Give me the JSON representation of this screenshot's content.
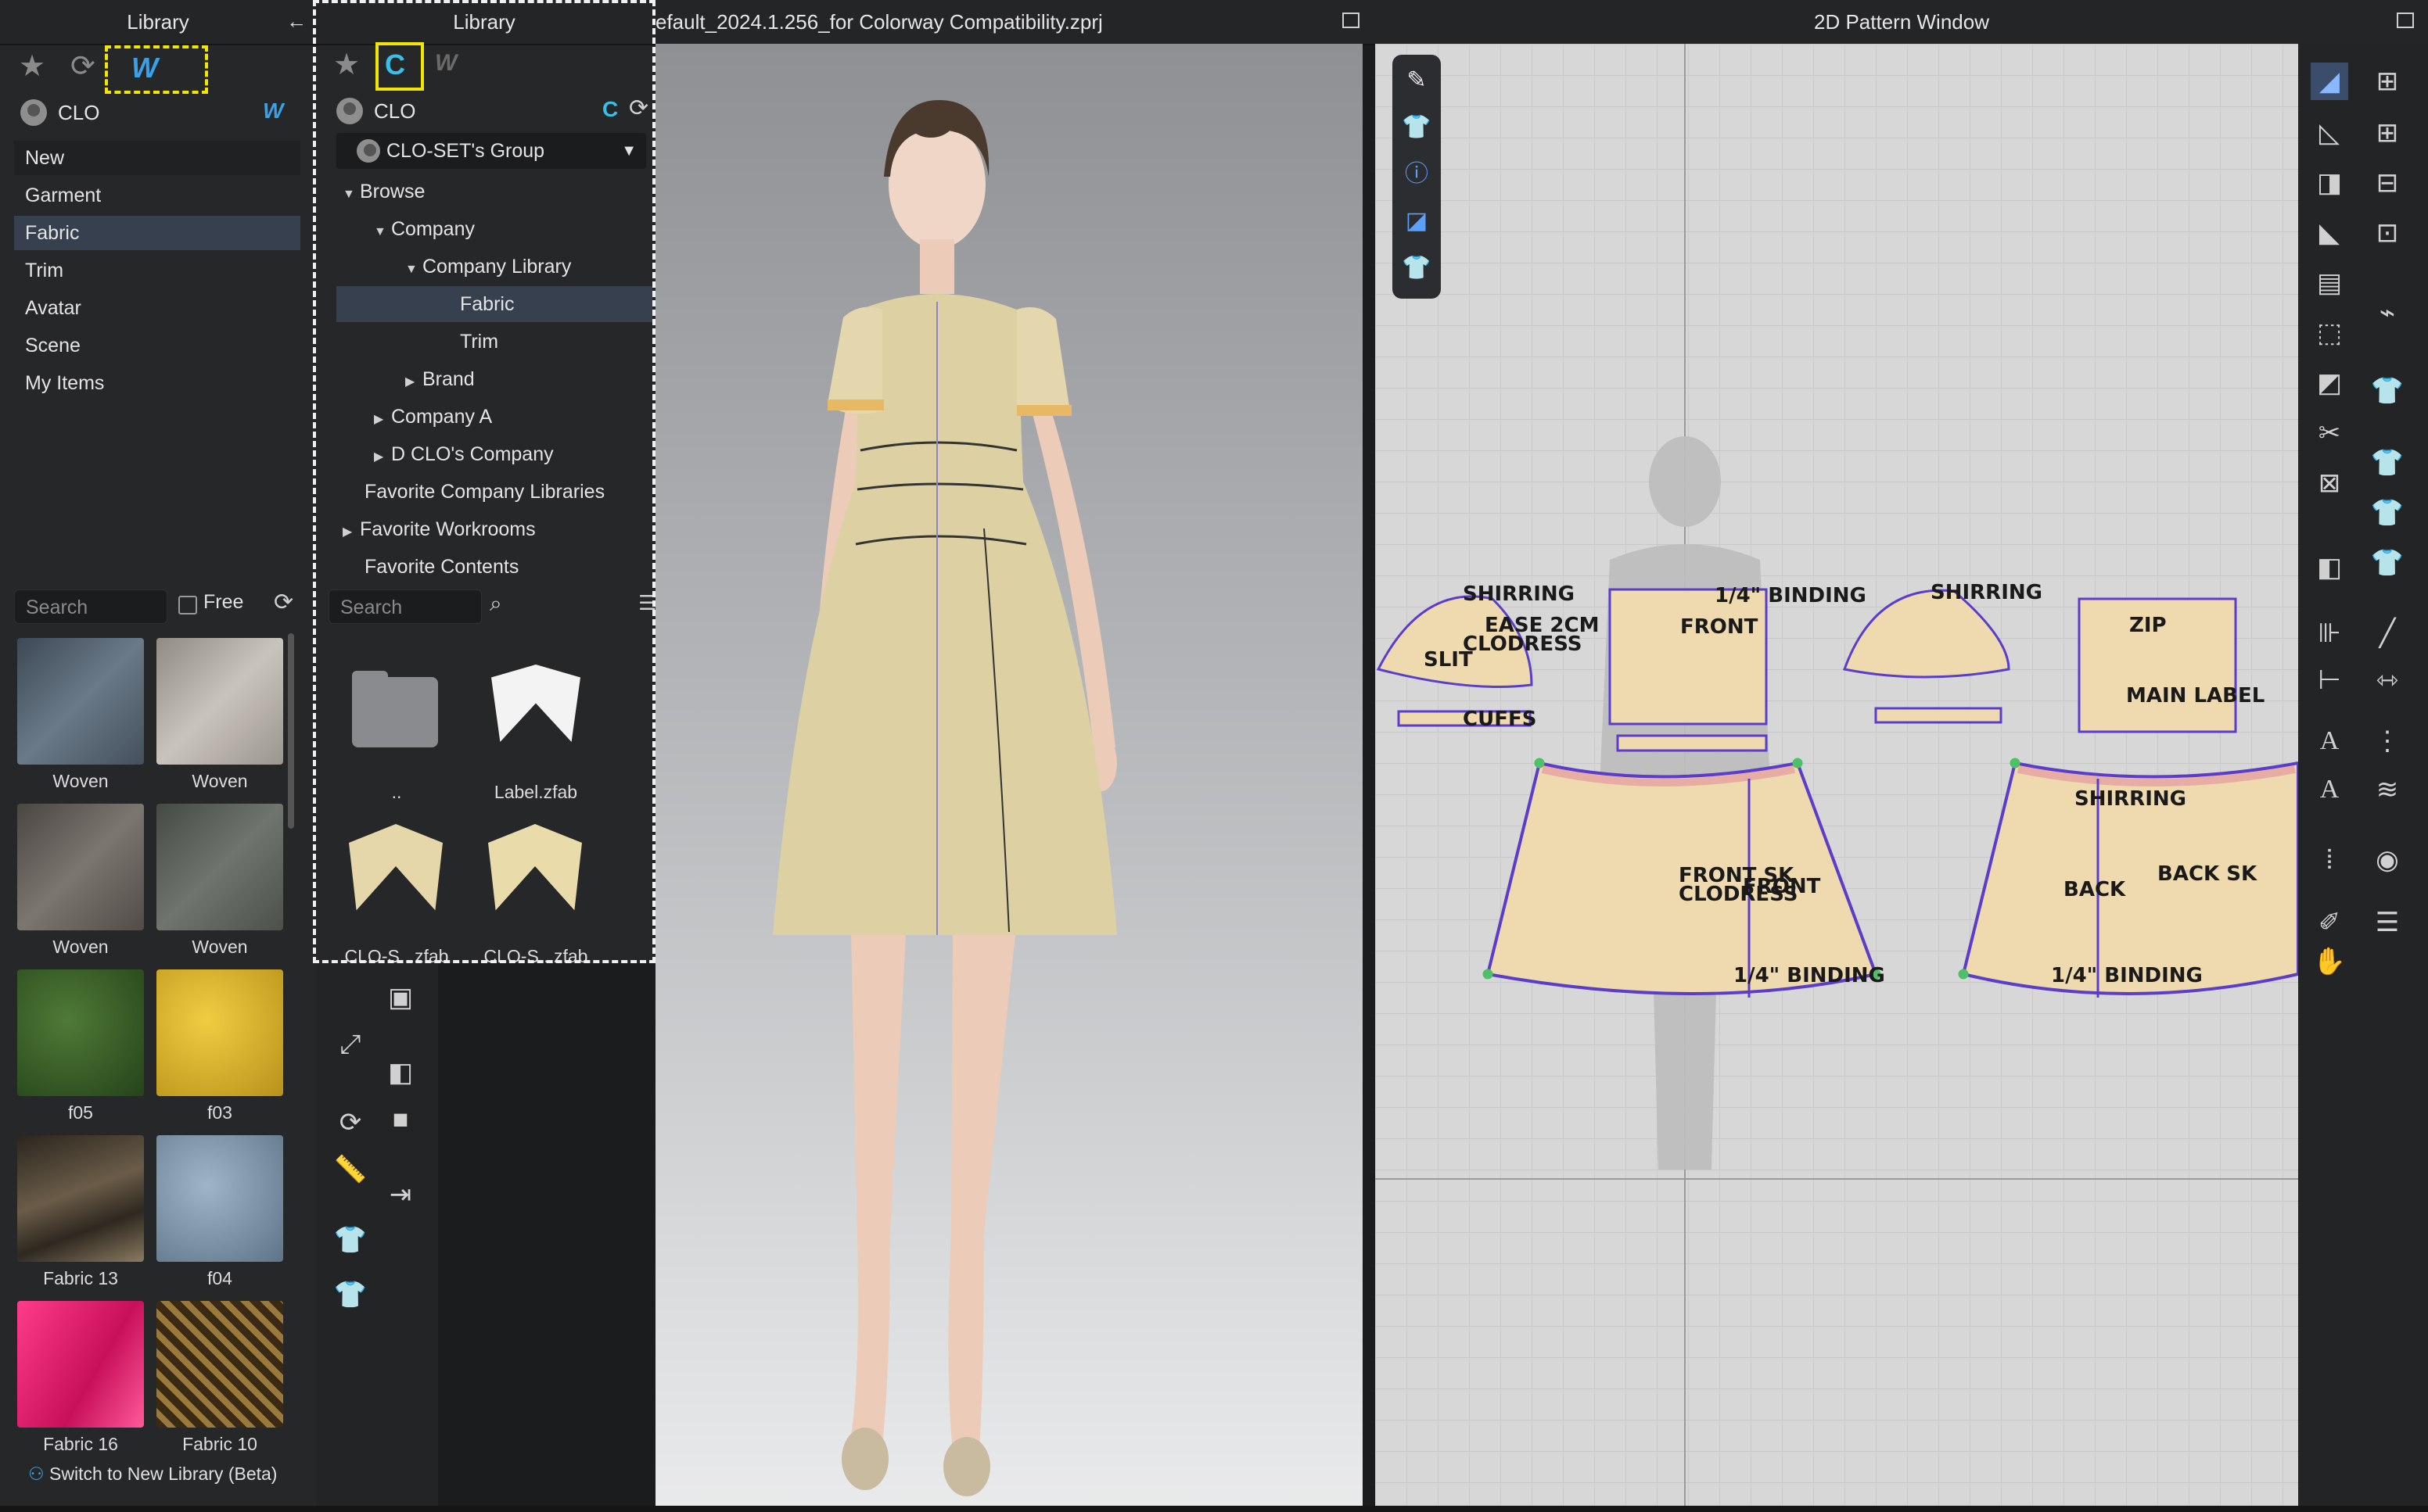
{
  "library": {
    "title": "Library",
    "user": "CLO",
    "nav": [
      "New",
      "Garment",
      "Fabric",
      "Trim",
      "Avatar",
      "Scene",
      "My Items"
    ],
    "selected_nav": "Fabric",
    "search_placeholder": "Search",
    "free_label": "Free",
    "tiles": [
      {
        "label": "Woven",
        "color": "#4d5a66"
      },
      {
        "label": "Woven",
        "color": "#a9a49b"
      },
      {
        "label": "Woven",
        "color": "#5e5a55"
      },
      {
        "label": "Woven",
        "color": "#555a54"
      },
      {
        "label": "f05",
        "color": "#355a24"
      },
      {
        "label": "f03",
        "color": "#d9b52c"
      },
      {
        "label": "Fabric 13",
        "color": "#3c352b"
      },
      {
        "label": "f04",
        "color": "#7f95a8"
      },
      {
        "label": "Fabric 16",
        "color": "#e2206a"
      },
      {
        "label": "Fabric 10",
        "color": "#5a4424"
      }
    ],
    "footer": "Switch to New Library (Beta)"
  },
  "library2": {
    "title": "Library",
    "user": "CLO",
    "group": "CLO-SET's Group",
    "tree": [
      {
        "label": "Browse",
        "level": 0,
        "arrow": "▼"
      },
      {
        "label": "Company",
        "level": 1,
        "arrow": "▼"
      },
      {
        "label": "Company Library",
        "level": 2,
        "arrow": "▼"
      },
      {
        "label": "Fabric",
        "level": 3,
        "arrow": "",
        "selected": true
      },
      {
        "label": "Trim",
        "level": 3,
        "arrow": ""
      },
      {
        "label": "Brand",
        "level": 2,
        "arrow": "▶"
      },
      {
        "label": "Company A",
        "level": 1,
        "arrow": "▶"
      },
      {
        "label": "D CLO's Company",
        "level": 1,
        "arrow": "▶"
      },
      {
        "label": "Favorite Company Libraries",
        "level": 0,
        "arrow": ""
      },
      {
        "label": "Favorite Workrooms",
        "level": 0,
        "arrow": "▶"
      },
      {
        "label": "Favorite Contents",
        "level": 0,
        "arrow": ""
      }
    ],
    "search_placeholder": "Search",
    "files": [
      "..",
      "Label.zfab",
      "CLO-S...zfab",
      "CLO-S...zfab"
    ]
  },
  "viewport": {
    "title": "efault_2024.1.256_for Colorway Compatibility.zprj"
  },
  "pattern": {
    "title": "2D Pattern Window",
    "labels": [
      "SHIRRING",
      "EASE 2CM",
      "CLODRESS",
      "SLIT",
      "CUFFS",
      "1/4\" BINDING",
      "FRONT",
      "SHIRRING",
      "FRONT SK",
      "CLODRESS",
      "FRONT",
      "1/4\" BINDING",
      "BACK",
      "BACK SK",
      "SHIRRING",
      "1/4\" BINDING",
      "MAIN LABEL",
      "ZIP"
    ]
  }
}
